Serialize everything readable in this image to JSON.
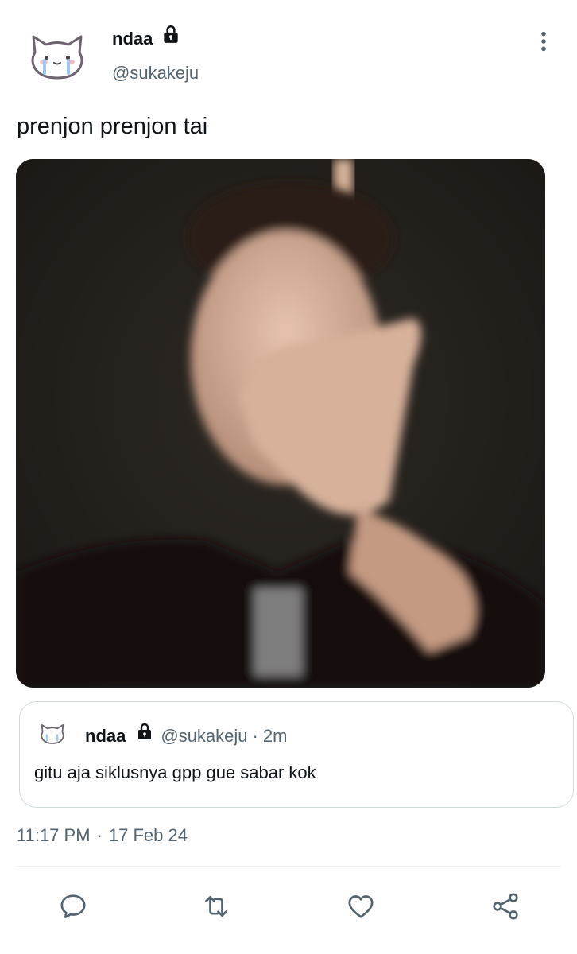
{
  "author": {
    "display_name": "ndaa",
    "handle": "@sukakeju",
    "avatar_icon": "cat-face-icon",
    "protected_icon": "lock-icon"
  },
  "tweet": {
    "text": "prenjon prenjon tai",
    "media_description": "photo-icon"
  },
  "quote": {
    "display_name": "ndaa",
    "handle": "@sukakeju",
    "separator": "·",
    "time": "2m",
    "text": "gitu aja siklusnya gpp gue sabar kok"
  },
  "meta": {
    "time": "11:17 PM",
    "separator": "·",
    "date": "17 Feb 24"
  },
  "actions": {
    "reply_icon": "reply-icon",
    "retweet_icon": "retweet-icon",
    "like_icon": "heart-icon",
    "share_icon": "share-icon"
  },
  "colors": {
    "primary_text": "#0f1419",
    "secondary_text": "#536471",
    "border": "#cfd9de",
    "divider": "#eff3f4"
  }
}
